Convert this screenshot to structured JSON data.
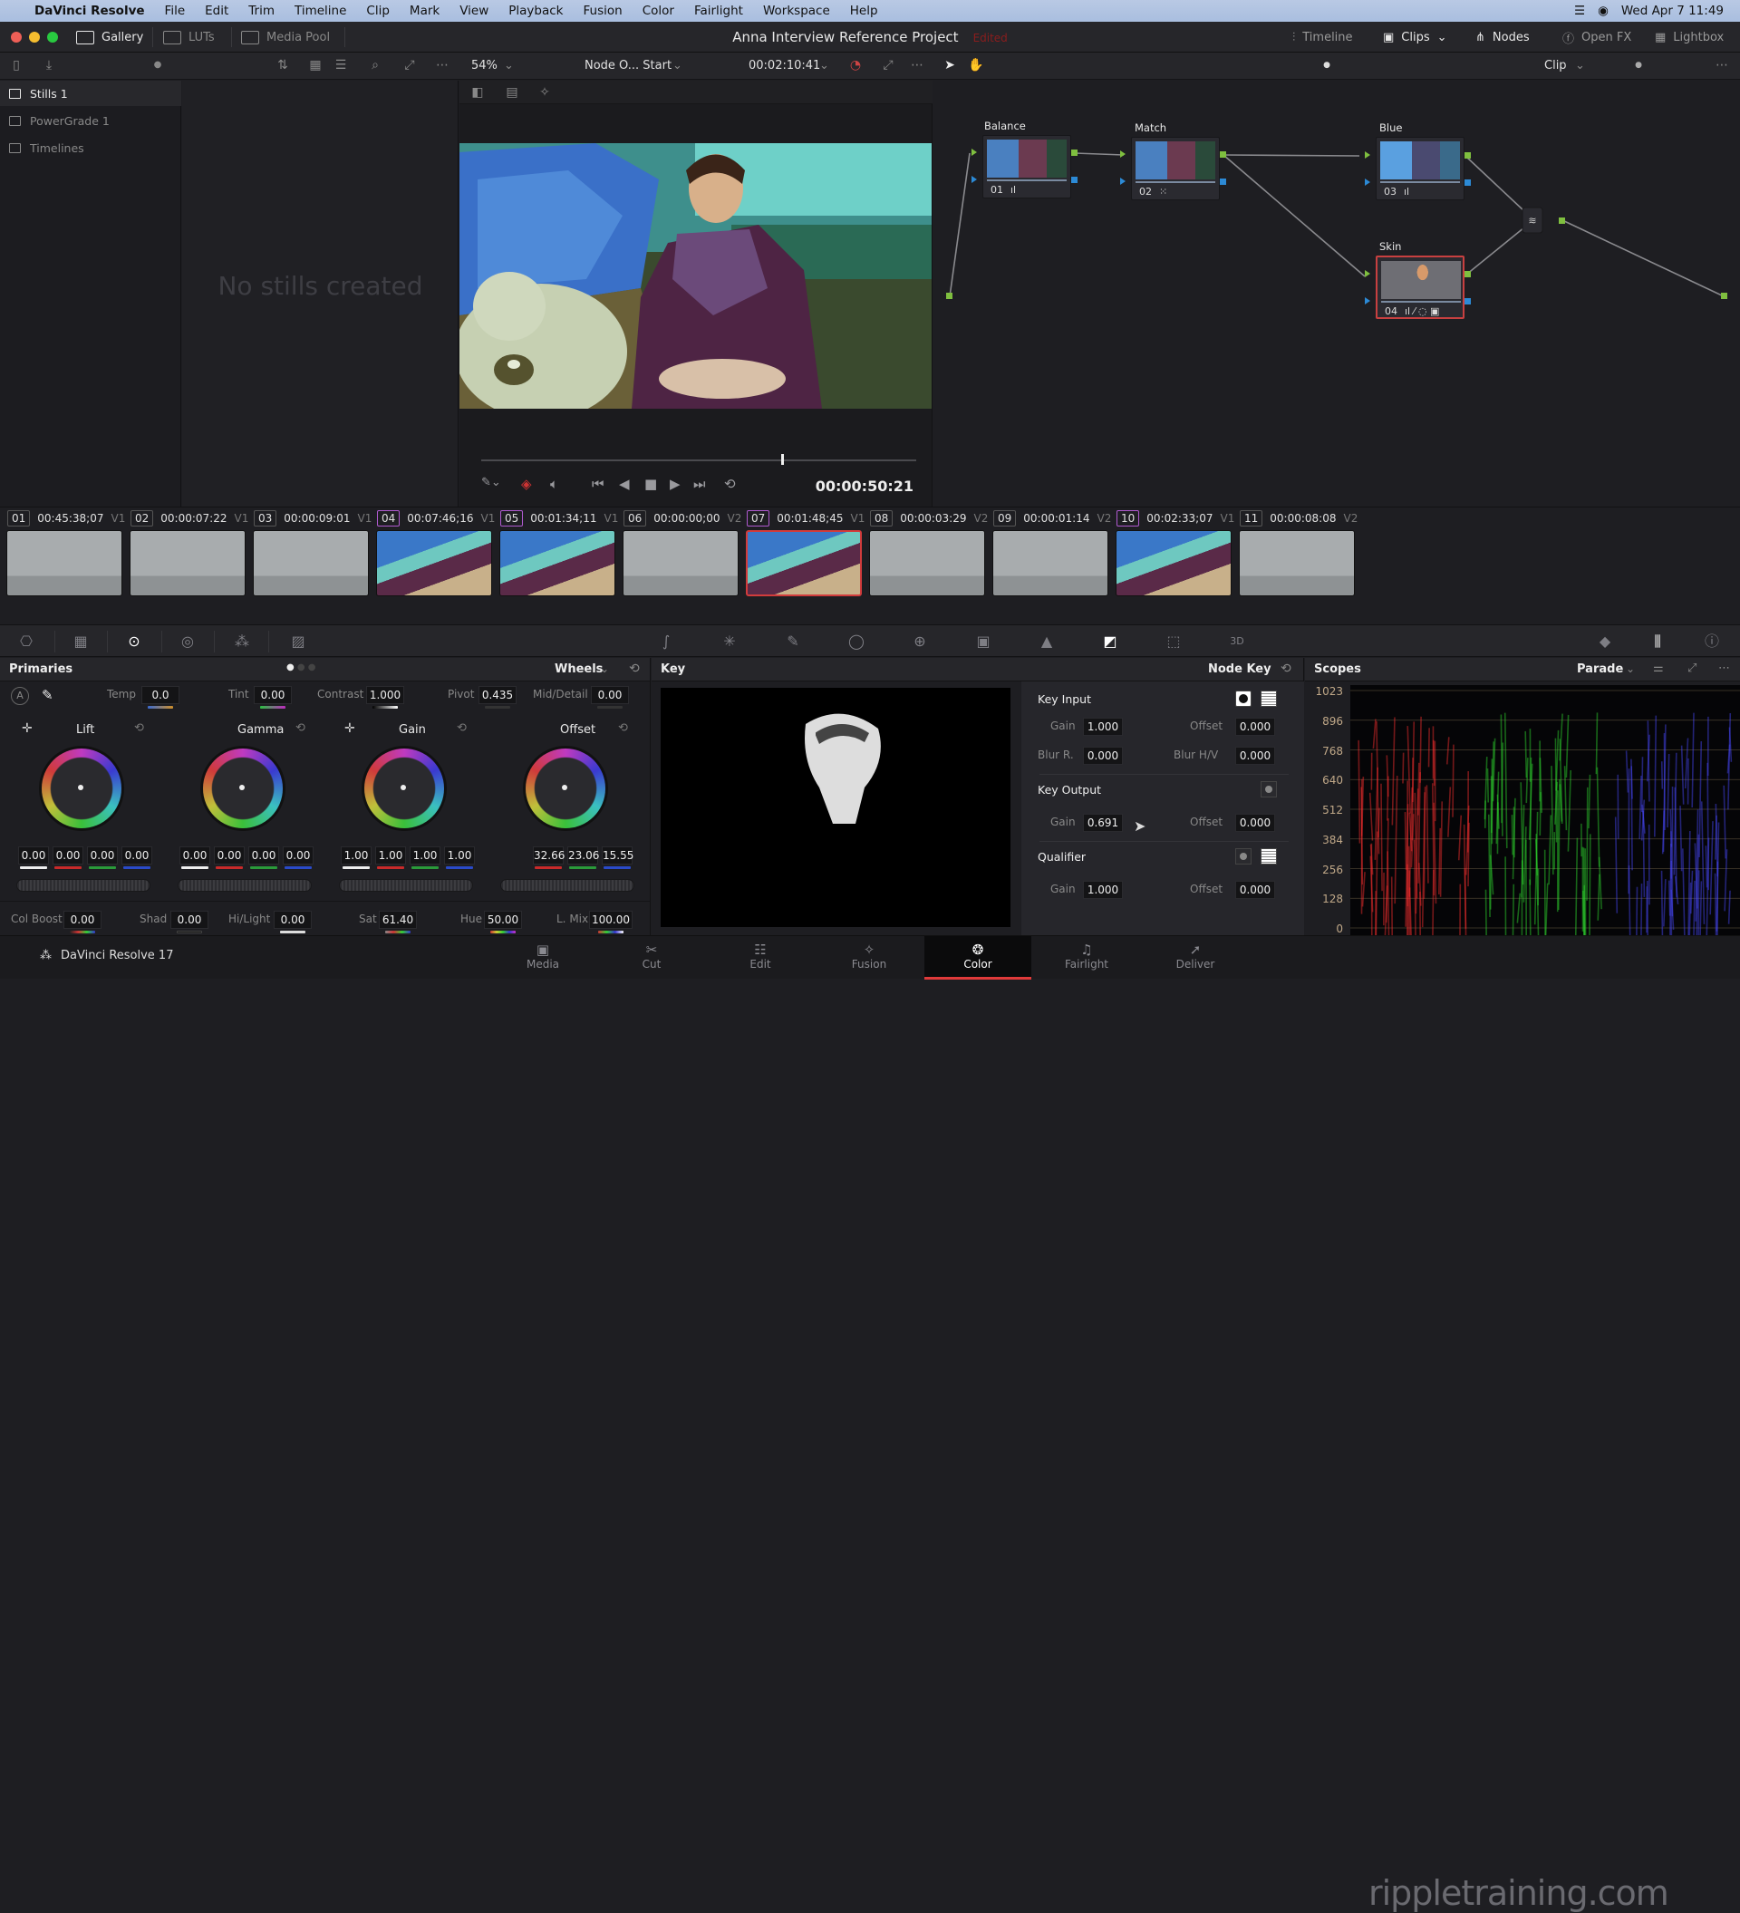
{
  "menubar": {
    "app": "DaVinci Resolve",
    "items": [
      "File",
      "Edit",
      "Trim",
      "Timeline",
      "Clip",
      "Mark",
      "View",
      "Playback",
      "Fusion",
      "Color",
      "Fairlight",
      "Workspace",
      "Help"
    ],
    "clock": "Wed Apr 7  11:49"
  },
  "titlebar": {
    "tabs": [
      {
        "label": "Gallery",
        "active": true
      },
      {
        "label": "LUTs",
        "active": false
      },
      {
        "label": "Media Pool",
        "active": false
      }
    ],
    "project_title": "Anna Interview Reference Project",
    "status": "Edited",
    "right_tabs": [
      {
        "label": "Timeline",
        "active": false
      },
      {
        "label": "Clips",
        "active": true
      },
      {
        "label": "Nodes",
        "active": true
      },
      {
        "label": "Open FX",
        "active": false
      },
      {
        "label": "Lightbox",
        "active": false
      }
    ]
  },
  "toolbar": {
    "zoom": "54%",
    "node_dropdown": "Node O... Start",
    "timecode": "00:02:10:41",
    "clip_mode": "Clip"
  },
  "gallery": {
    "albums": [
      {
        "label": "Stills 1",
        "active": true
      },
      {
        "label": "PowerGrade 1",
        "active": false
      },
      {
        "label": "Timelines",
        "active": false
      }
    ],
    "empty_message": "No stills created"
  },
  "viewer": {
    "timecode": "00:00:50:21",
    "playhead_fraction": 0.69
  },
  "nodes": [
    {
      "label": "Balance",
      "num": "01",
      "icon": "bars"
    },
    {
      "label": "Match",
      "num": "02",
      "icon": "grid"
    },
    {
      "label": "Blue",
      "num": "03",
      "icon": "bars"
    },
    {
      "label": "Skin",
      "num": "04",
      "icon": "multi",
      "selected": true
    }
  ],
  "clips": [
    {
      "idx": "01",
      "tc": "00:45:38;07",
      "track": "V1",
      "type": "ballet"
    },
    {
      "idx": "02",
      "tc": "00:00:07:22",
      "track": "V1",
      "type": "ballet"
    },
    {
      "idx": "03",
      "tc": "00:00:09:01",
      "track": "V1",
      "type": "ballet"
    },
    {
      "idx": "04",
      "tc": "00:07:46;16",
      "track": "V1",
      "type": "interview"
    },
    {
      "idx": "05",
      "tc": "00:01:34;11",
      "track": "V1",
      "type": "interview"
    },
    {
      "idx": "06",
      "tc": "00:00:00;00",
      "track": "V2",
      "type": "ballet"
    },
    {
      "idx": "07",
      "tc": "00:01:48;45",
      "track": "V1",
      "type": "interview",
      "selected": true
    },
    {
      "idx": "08",
      "tc": "00:00:03:29",
      "track": "V2",
      "type": "ballet"
    },
    {
      "idx": "09",
      "tc": "00:00:01:14",
      "track": "V2",
      "type": "ballet"
    },
    {
      "idx": "10",
      "tc": "00:02:33;07",
      "track": "V1",
      "type": "interview"
    },
    {
      "idx": "11",
      "tc": "00:00:08:08",
      "track": "V2",
      "type": "ballet"
    }
  ],
  "primaries": {
    "title": "Primaries",
    "mode": "Wheels",
    "temp": {
      "label": "Temp",
      "value": "0.0"
    },
    "tint": {
      "label": "Tint",
      "value": "0.00"
    },
    "contrast": {
      "label": "Contrast",
      "value": "1.000"
    },
    "pivot": {
      "label": "Pivot",
      "value": "0.435"
    },
    "middetail": {
      "label": "Mid/Detail",
      "value": "0.00"
    },
    "wheels": [
      {
        "label": "Lift",
        "values": [
          "0.00",
          "0.00",
          "0.00",
          "0.00"
        ]
      },
      {
        "label": "Gamma",
        "values": [
          "0.00",
          "0.00",
          "0.00",
          "0.00"
        ]
      },
      {
        "label": "Gain",
        "values": [
          "1.00",
          "1.00",
          "1.00",
          "1.00"
        ]
      },
      {
        "label": "Offset",
        "values": [
          "32.66",
          "23.06",
          "15.55"
        ]
      }
    ],
    "colboost": {
      "label": "Col Boost",
      "value": "0.00"
    },
    "shad": {
      "label": "Shad",
      "value": "0.00"
    },
    "hilight": {
      "label": "Hi/Light",
      "value": "0.00"
    },
    "sat": {
      "label": "Sat",
      "value": "61.40"
    },
    "hue": {
      "label": "Hue",
      "value": "50.00"
    },
    "lmix": {
      "label": "L. Mix",
      "value": "100.00"
    }
  },
  "key": {
    "title": "Key",
    "mode": "Node Key",
    "key_input": {
      "label": "Key Input",
      "gain_label": "Gain",
      "gain": "1.000",
      "offset_label": "Offset",
      "offset": "0.000",
      "blur_r_label": "Blur R.",
      "blur_r": "0.000",
      "blur_hv_label": "Blur H/V",
      "blur_hv": "0.000"
    },
    "key_output": {
      "label": "Key Output",
      "gain_label": "Gain",
      "gain": "0.691",
      "offset_label": "Offset",
      "offset": "0.000"
    },
    "qualifier": {
      "label": "Qualifier",
      "gain_label": "Gain",
      "gain": "1.000",
      "offset_label": "Offset",
      "offset": "0.000"
    }
  },
  "scopes": {
    "title": "Scopes",
    "mode": "Parade",
    "scale": [
      "1023",
      "896",
      "768",
      "640",
      "512",
      "384",
      "256",
      "128",
      "0"
    ]
  },
  "pages": [
    {
      "label": "Media",
      "icon": "▣"
    },
    {
      "label": "Cut",
      "icon": "✂"
    },
    {
      "label": "Edit",
      "icon": "☷"
    },
    {
      "label": "Fusion",
      "icon": "✧"
    },
    {
      "label": "Color",
      "icon": "❂",
      "active": true
    },
    {
      "label": "Fairlight",
      "icon": "♫"
    },
    {
      "label": "Deliver",
      "icon": "➚"
    }
  ],
  "brand": "DaVinci Resolve 17",
  "watermark": "rippletraining.com"
}
